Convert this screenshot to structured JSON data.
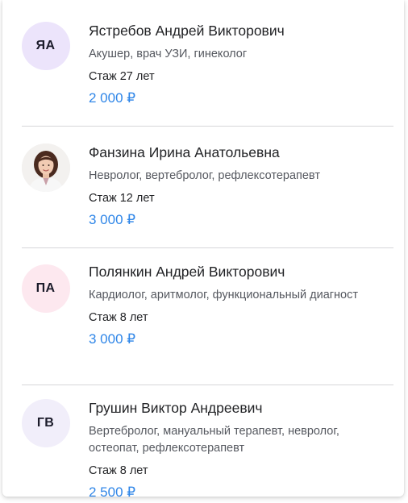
{
  "doctors": [
    {
      "initials": "ЯА",
      "avatar_color": "#ece4fb",
      "name": "Ястребов Андрей Викторович",
      "specialty": "Акушер, врач УЗИ, гинеколог",
      "experience": "Стаж 27 лет",
      "price": "2 000 ₽"
    },
    {
      "initials": "",
      "avatar_color": "#eeeeee",
      "photo_icon": "doctor-photo",
      "name": "Фанзина Ирина Анатольевна",
      "specialty": "Невролог, вертебролог, рефлексотерапевт",
      "experience": "Стаж 12 лет",
      "price": "3 000 ₽"
    },
    {
      "initials": "ПА",
      "avatar_color": "#fde8ef",
      "name": "Полянкин Андрей Викторович",
      "specialty": "Кардиолог, аритмолог, функциональный диагност",
      "experience": "Стаж 8 лет",
      "price": "3 000 ₽"
    },
    {
      "initials": "ГВ",
      "avatar_color": "#f1eefa",
      "name": "Грушин Виктор Андреевич",
      "specialty": "Вертебролог, мануальный терапевт, невролог, остеопат, рефлексотерапевт",
      "experience": "Стаж 8 лет",
      "price": "2 500 ₽"
    }
  ],
  "colors": {
    "price": "#2f86e8",
    "divider": "#d6d6d9"
  }
}
